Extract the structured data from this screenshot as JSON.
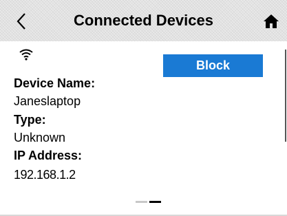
{
  "header": {
    "title": "Connected Devices",
    "back_icon": "chevron-left-icon",
    "home_icon": "home-icon"
  },
  "device": {
    "status_icon": "wifi-icon",
    "block_label": "Block",
    "name_label": "Device Name:",
    "name_value": "Janeslaptop",
    "type_label": "Type:",
    "type_value": "Unknown",
    "ip_label": "IP Address:",
    "ip_value": "192.168.1.2"
  },
  "pager": {
    "page_count": 2,
    "current_page": 2
  },
  "colors": {
    "accent": "#1a7ad4",
    "header_bg": "#e9e9e9"
  }
}
